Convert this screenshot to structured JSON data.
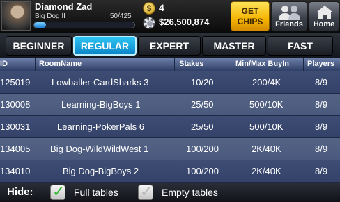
{
  "profile": {
    "name": "Diamond Zad",
    "rank": "Big Dog II",
    "xp_text": "50/425",
    "xp_progress": 0.118
  },
  "currency": {
    "coins": "4",
    "chips": "$26,500,874"
  },
  "buttons": {
    "get_chips_line1": "GET",
    "get_chips_line2": "CHIPS",
    "friends": "Friends",
    "home": "Home"
  },
  "tabs": [
    {
      "label": "BEGINNER",
      "active": false
    },
    {
      "label": "REGULAR",
      "active": true
    },
    {
      "label": "EXPERT",
      "active": false
    },
    {
      "label": "MASTER",
      "active": false
    },
    {
      "label": "FAST",
      "active": false
    }
  ],
  "table": {
    "headers": [
      "ID",
      "RoomName",
      "Stakes",
      "Min/Max BuyIn",
      "Players"
    ],
    "rows": [
      {
        "id": "125019",
        "room": "Lowballer-CardSharks 3",
        "stakes": "10/20",
        "buyin": "200/4K",
        "players": "8/9"
      },
      {
        "id": "130008",
        "room": "Learning-BigBoys 1",
        "stakes": "25/50",
        "buyin": "500/10K",
        "players": "8/9"
      },
      {
        "id": "130031",
        "room": "Learning-PokerPals 6",
        "stakes": "25/50",
        "buyin": "500/10K",
        "players": "8/9"
      },
      {
        "id": "134005",
        "room": "Big Dog-WildWildWest 1",
        "stakes": "100/200",
        "buyin": "2K/40K",
        "players": "8/9"
      },
      {
        "id": "134010",
        "room": "Big Dog-BigBoys 2",
        "stakes": "100/200",
        "buyin": "2K/40K",
        "players": "8/9"
      }
    ]
  },
  "footer": {
    "hide_label": "Hide:",
    "full_tables": "Full tables",
    "full_tables_checked": true,
    "empty_tables": "Empty tables",
    "empty_tables_checked": true
  },
  "colors": {
    "active_tab": "#1aa7e0",
    "get_chips": "#f5b400",
    "row_dark": "#3a4870",
    "row_light": "#4f5e82",
    "header": "#4a5c88"
  },
  "icons": [
    "coin-icon",
    "chip-icon",
    "friends-icon",
    "home-icon",
    "checkmark-icon"
  ]
}
